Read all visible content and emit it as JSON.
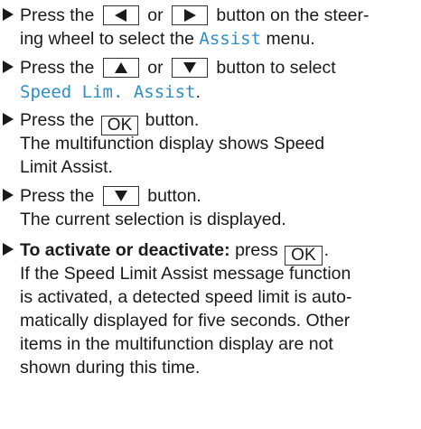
{
  "steps": [
    {
      "lines": [
        {
          "a": "Press the",
          "b": "or",
          "c": "button on the steer-"
        },
        {
          "text": "ing wheel to select the",
          "menu": "Assist",
          "end": "menu."
        }
      ]
    },
    {
      "lines": [
        {
          "a": "Press the",
          "b": "or",
          "c": "button to select"
        },
        {
          "menu": "Speed Lim. Assist",
          "end": "."
        }
      ]
    },
    {
      "lines": [
        {
          "a": "Press the",
          "key": "OK",
          "c": "button."
        },
        {
          "text": "The multifunction display shows Speed"
        },
        {
          "text": "Limit Assist."
        }
      ]
    },
    {
      "lines": [
        {
          "a": "Press the",
          "c": "button."
        },
        {
          "text": "The current selection is displayed."
        }
      ]
    },
    {
      "lines": [
        {
          "bold": "To activate or deactivate:",
          "a": "press",
          "key": "OK",
          "end": "."
        },
        {
          "text": "If the Speed Limit Assist message function"
        },
        {
          "text": "is activated, a detected speed limit is auto-"
        },
        {
          "text": "matically displayed for five seconds. Other"
        },
        {
          "text": "items in the multifunction display are not"
        },
        {
          "text": "shown during this time."
        }
      ]
    }
  ],
  "colors": {
    "menu_text": "#2f8fc5",
    "text": "#1a1a1a"
  },
  "icons": [
    "arrow-bullet-icon",
    "left-arrow-key-icon",
    "right-arrow-key-icon",
    "up-arrow-key-icon",
    "down-arrow-key-icon"
  ]
}
